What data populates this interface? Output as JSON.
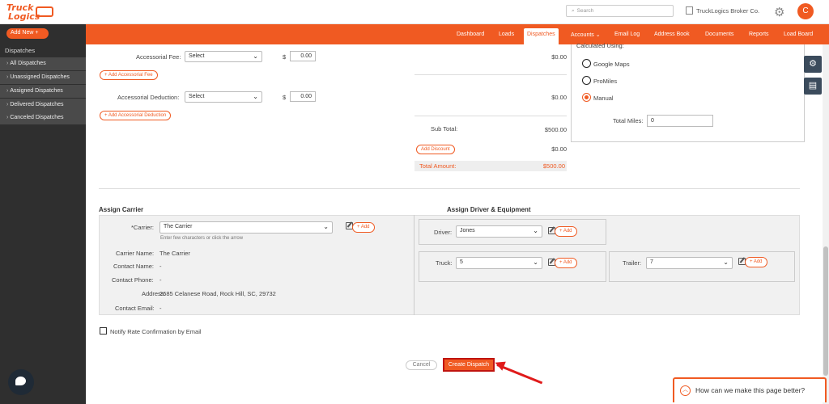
{
  "header": {
    "logo_line1": "Truck",
    "logo_line2": "Logics",
    "search_placeholder": "Search",
    "company": "TruckLogics Broker Co.",
    "avatar_initial": "C"
  },
  "nav": {
    "items": [
      "Dashboard",
      "Loads",
      "Dispatches",
      "Accounts ⌄",
      "Email Log",
      "Address Book",
      "Documents",
      "Reports",
      "Load Board"
    ],
    "active": "Dispatches"
  },
  "sidebar": {
    "add_new": "Add New  +",
    "heading": "Dispatches",
    "items": [
      "All Dispatches",
      "Unassigned Dispatches",
      "Assigned Dispatches",
      "Delivered Dispatches",
      "Canceled Dispatches"
    ]
  },
  "charges": {
    "accessorial_fee_label": "Accessorial Fee:",
    "accessorial_fee_select": "Select",
    "accessorial_fee_amount": "0.00",
    "accessorial_fee_total": "$0.00",
    "add_accessorial_fee": "+ Add Accessorial Fee",
    "accessorial_deduction_label": "Accessorial Deduction:",
    "accessorial_deduction_select": "Select",
    "accessorial_deduction_amount": "0.00",
    "accessorial_deduction_total": "$0.00",
    "add_accessorial_deduction": "+ Add Accessorial Deduction",
    "currency_symbol": "$",
    "subtotal_label": "Sub Total:",
    "subtotal_value": "$500.00",
    "add_discount": "Add Discount",
    "discount_value": "$0.00",
    "total_label": "Total Amount:",
    "total_value": "$500.00"
  },
  "calculated": {
    "heading": "Calculated Using:",
    "options": [
      "Google Maps",
      "ProMiles",
      "Manual"
    ],
    "selected": "Manual",
    "total_miles_label": "Total Miles:",
    "total_miles_value": "0"
  },
  "carrier": {
    "section_title": "Assign Carrier",
    "carrier_label": "*Carrier:",
    "carrier_value": "The Carrier",
    "carrier_hint": "Enter few characters or click the arrow",
    "add_label": "+ Add",
    "fields": [
      {
        "label": "Carrier Name:",
        "value": "The Carrier"
      },
      {
        "label": "Contact Name:",
        "value": "-"
      },
      {
        "label": "Contact Phone:",
        "value": "-"
      },
      {
        "label": "Address:",
        "value": "2685 Celanese Road, Rock Hill, SC, 29732"
      },
      {
        "label": "Contact Email:",
        "value": "-"
      }
    ]
  },
  "driver": {
    "section_title": "Assign Driver & Equipment",
    "driver_label": "Driver:",
    "driver_value": "Jones",
    "truck_label": "Truck:",
    "truck_value": "5",
    "trailer_label": "Trailer:",
    "trailer_value": "7",
    "add_label": "+ Add"
  },
  "notify_label": "Notify Rate Confirmation by Email",
  "actions": {
    "cancel": "Cancel",
    "create": "Create Dispatch"
  },
  "feedback": {
    "text": "How can we make this page better?",
    "up_glyph": "︿"
  },
  "icons": {
    "tool1": "⚙",
    "tool2": "▤",
    "gear": "⚙",
    "search": "⌕",
    "caret": "⌄"
  },
  "colors": {
    "brand": "#f05a22",
    "sidebar": "#2f2f2f",
    "highlight": "#e01b1b"
  }
}
